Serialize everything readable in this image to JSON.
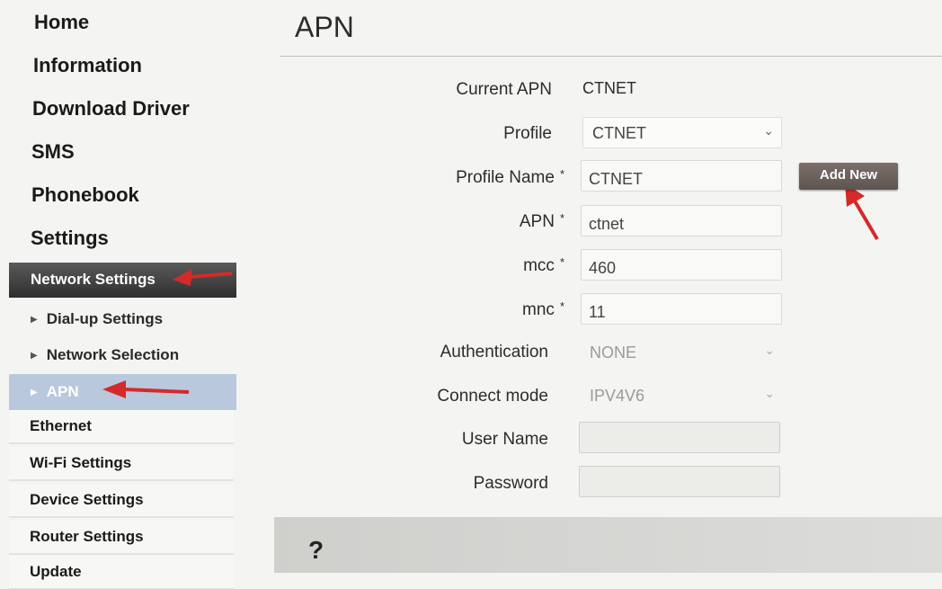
{
  "sidebar": {
    "home": "Home",
    "information": "Information",
    "download_driver": "Download Driver",
    "sms": "SMS",
    "phonebook": "Phonebook",
    "settings": "Settings",
    "network_settings": "Network Settings",
    "sub_items": [
      "Dial-up Settings",
      "Network Selection",
      "APN"
    ],
    "lower_items": [
      "Ethernet",
      "Wi-Fi Settings",
      "Device Settings",
      "Router Settings",
      "Update"
    ]
  },
  "page": {
    "title": "APN"
  },
  "form": {
    "current_apn_label": "Current APN",
    "current_apn_value": "CTNET",
    "profile_label": "Profile",
    "profile_value": "CTNET",
    "profile_name_label": "Profile Name",
    "profile_name_value": "CTNET",
    "apn_label": "APN",
    "apn_value": "ctnet",
    "mcc_label": "mcc",
    "mcc_value": "460",
    "mnc_label": "mnc",
    "mnc_value": "11",
    "authentication_label": "Authentication",
    "authentication_value": "NONE",
    "connect_mode_label": "Connect mode",
    "connect_mode_value": "IPV4V6",
    "user_name_label": "User Name",
    "user_name_value": "",
    "password_label": "Password",
    "password_value": "",
    "required_mark": "*",
    "add_new": "Add New"
  },
  "help": {
    "icon": "?"
  },
  "colors": {
    "nav_active_bg": "#b9c8dc",
    "network_settings_bg": "#3c3c3c",
    "arrow": "#d42a2a",
    "add_new_bg": "#6a605c"
  }
}
